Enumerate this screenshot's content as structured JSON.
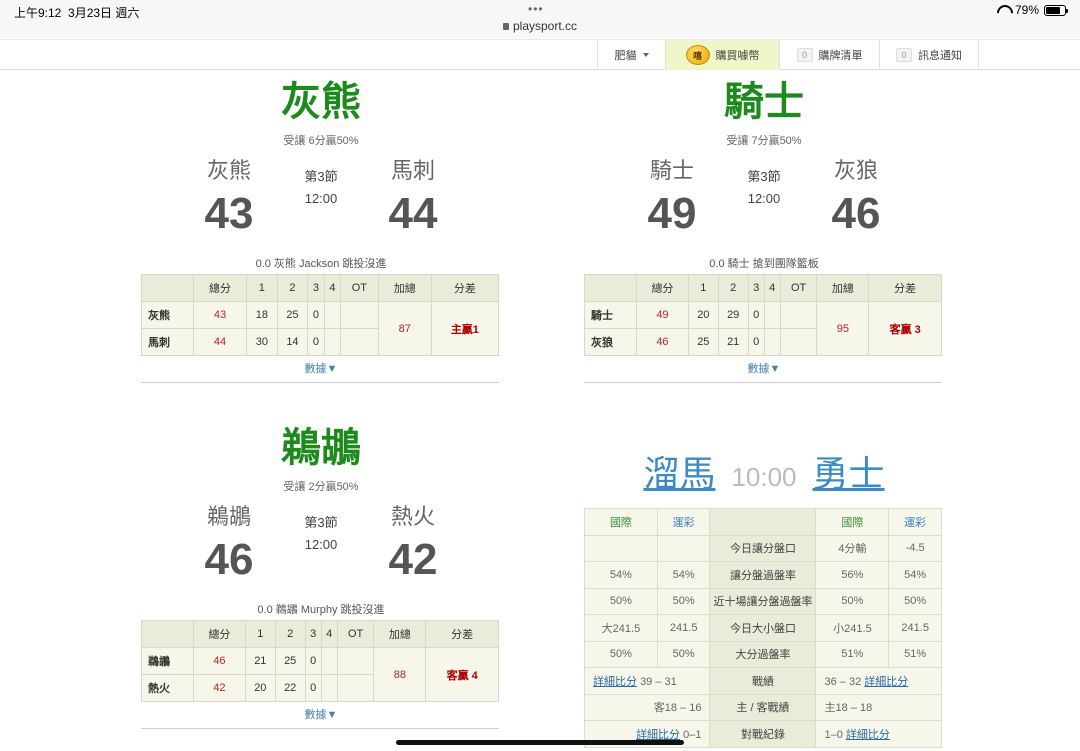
{
  "status_bar": {
    "time": "上午9:12",
    "date": "3月23日 週六",
    "dots": "•••",
    "url": "playsport.cc",
    "battery": "79%",
    "battery_level": 0.79
  },
  "nav": {
    "user": "肥貓",
    "coin_label": "嘻",
    "buy": "購買噱幣",
    "cart_count": "0",
    "cart": "購牌清單",
    "notice_count": "0",
    "notice": "訊息通知"
  },
  "games": [
    {
      "title": "灰熊",
      "spread": "受讓 6分贏50%",
      "away": "灰熊",
      "away_pts": "43",
      "home": "馬刺",
      "home_pts": "44",
      "period": "第3節",
      "clock": "12:00",
      "play": "0.0 灰熊 Jackson 跳投沒進",
      "headers": [
        "總分",
        "1",
        "2",
        "3",
        "4",
        "OT",
        "加總",
        "分差"
      ],
      "rows": [
        {
          "team": "灰熊",
          "total": "43",
          "q1": "18",
          "q2": "25",
          "q3": "0",
          "q4": "",
          "ot": ""
        },
        {
          "team": "馬刺",
          "total": "44",
          "q1": "30",
          "q2": "14",
          "q3": "0",
          "q4": "",
          "ot": ""
        }
      ],
      "sum": "87",
      "diff": "主贏1",
      "more": "數據▼"
    },
    {
      "title": "騎士",
      "spread": "受讓 7分贏50%",
      "away": "騎士",
      "away_pts": "49",
      "home": "灰狼",
      "home_pts": "46",
      "period": "第3節",
      "clock": "12:00",
      "play": "0.0 騎士 搶到團隊籃板",
      "headers": [
        "總分",
        "1",
        "2",
        "3",
        "4",
        "OT",
        "加總",
        "分差"
      ],
      "rows": [
        {
          "team": "騎士",
          "total": "49",
          "q1": "20",
          "q2": "29",
          "q3": "0",
          "q4": "",
          "ot": ""
        },
        {
          "team": "灰狼",
          "total": "46",
          "q1": "25",
          "q2": "21",
          "q3": "0",
          "q4": "",
          "ot": ""
        }
      ],
      "sum": "95",
      "diff": "客贏 3",
      "more": "數據▼"
    },
    {
      "title": "鵜鶘",
      "spread": "受讓 2分贏50%",
      "away": "鵜鶘",
      "away_pts": "46",
      "home": "熱火",
      "home_pts": "42",
      "period": "第3節",
      "clock": "12:00",
      "play": "0.0 鵜鶘 Murphy 跳投沒進",
      "headers": [
        "總分",
        "1",
        "2",
        "3",
        "4",
        "OT",
        "加總",
        "分差"
      ],
      "rows": [
        {
          "team": "鵜鶘",
          "total": "46",
          "q1": "21",
          "q2": "25",
          "q3": "0",
          "q4": "",
          "ot": ""
        },
        {
          "team": "熱火",
          "total": "42",
          "q1": "20",
          "q2": "22",
          "q3": "0",
          "q4": "",
          "ot": ""
        }
      ],
      "sum": "88",
      "diff": "客贏 4",
      "more": "數據▼"
    }
  ],
  "upcoming": {
    "away": "溜馬",
    "time": "10:00",
    "home": "勇士",
    "col_intl": "國際",
    "col_sport": "運彩",
    "rows": [
      {
        "l1": "",
        "l2": "",
        "label": "今日讓分盤口",
        "r1": "4分輸",
        "r2": "-4.5"
      },
      {
        "l1": "54%",
        "l2": "54%",
        "label": "讓分盤過盤率",
        "r1": "56%",
        "r2": "54%"
      },
      {
        "l1": "50%",
        "l2": "50%",
        "label": "近十場讓分盤過盤率",
        "r1": "50%",
        "r2": "50%"
      },
      {
        "l1": "大241.5",
        "l2": "241.5",
        "label": "今日大小盤口",
        "r1": "小241.5",
        "r2": "241.5"
      },
      {
        "l1": "50%",
        "l2": "50%",
        "label": "大分過盤率",
        "r1": "51%",
        "r2": "51%"
      }
    ],
    "record": {
      "left_link": "詳細比分",
      "left_val": "39 – 31",
      "label": "戰績",
      "right_val": "36 – 32",
      "right_link": "詳細比分"
    },
    "homeaway": {
      "left_val": "客18 – 16",
      "label": "主 / 客戰績",
      "right_val": "主18 – 18"
    },
    "h2h": {
      "left_link": "詳細比分",
      "left_val": "0–1",
      "label": "對戰紀錄",
      "right_val": "1–0",
      "right_link": "詳細比分"
    }
  }
}
